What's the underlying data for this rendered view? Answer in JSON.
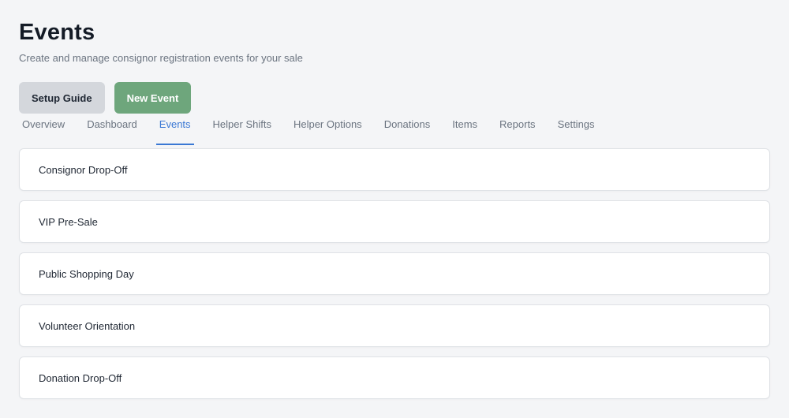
{
  "header": {
    "title": "Events",
    "subtitle": "Create and manage consignor registration events for your sale"
  },
  "actions": {
    "setup_guide_label": "Setup Guide",
    "new_event_label": "New Event"
  },
  "tabs": [
    {
      "label": "Overview",
      "active": false
    },
    {
      "label": "Dashboard",
      "active": false
    },
    {
      "label": "Events",
      "active": true
    },
    {
      "label": "Helper Shifts",
      "active": false
    },
    {
      "label": "Helper Options",
      "active": false
    },
    {
      "label": "Donations",
      "active": false
    },
    {
      "label": "Items",
      "active": false
    },
    {
      "label": "Reports",
      "active": false
    },
    {
      "label": "Settings",
      "active": false
    }
  ],
  "events": [
    {
      "name": "Consignor Drop-Off"
    },
    {
      "name": "VIP Pre-Sale"
    },
    {
      "name": "Public Shopping Day"
    },
    {
      "name": "Volunteer Orientation"
    },
    {
      "name": "Donation Drop-Off"
    }
  ],
  "colors": {
    "primary_button": "#6ea67c",
    "secondary_button": "#d4d7dc",
    "active_tab": "#3a78d4",
    "background": "#f4f5f7"
  }
}
